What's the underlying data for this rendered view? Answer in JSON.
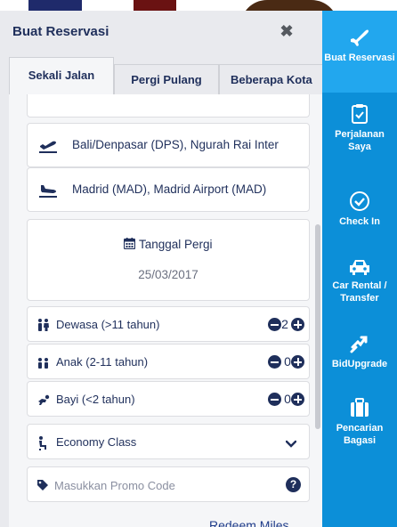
{
  "panel": {
    "title": "Buat Reservasi",
    "close_icon": "close-icon"
  },
  "tabs": [
    {
      "label": "Sekali Jalan",
      "active": true
    },
    {
      "label": "Pergi Pulang",
      "active": false
    },
    {
      "label": "Beberapa Kota",
      "active": false
    }
  ],
  "route": {
    "from": "Bali/Denpasar (DPS), Ngurah Rai Inter",
    "to": "Madrid (MAD), Madrid Airport (MAD)",
    "from_icon": "plane-departure-icon",
    "to_icon": "plane-arrival-icon"
  },
  "date": {
    "label": "Tanggal Pergi",
    "value": "25/03/2017",
    "icon": "calendar-icon"
  },
  "passengers": [
    {
      "label": "Dewasa (>11 tahun)",
      "count": "2",
      "icon": "adult-icon"
    },
    {
      "label": "Anak (2-11 tahun)",
      "count": "0",
      "icon": "child-icon"
    },
    {
      "label": "Bayi (<2 tahun)",
      "count": "0",
      "icon": "infant-icon"
    }
  ],
  "cabin_class": {
    "value": "Economy Class",
    "icon": "seat-icon"
  },
  "promo": {
    "placeholder": "Masukkan Promo Code",
    "icon": "tag-icon"
  },
  "redeem": {
    "label": "Redeem Miles"
  },
  "rail": [
    {
      "label": "Buat Reservasi",
      "icon": "plane-icon",
      "active": true
    },
    {
      "label": "Perjalanan Saya",
      "icon": "clipboard-check-icon",
      "active": false
    },
    {
      "label": "Check In",
      "icon": "check-circle-icon",
      "active": false
    },
    {
      "label": "Car Rental / Transfer",
      "icon": "car-icon",
      "active": false
    },
    {
      "label": "BidUpgrade",
      "icon": "upgrade-icon",
      "active": false
    },
    {
      "label": "Pencarian Bagasi",
      "icon": "luggage-icon",
      "active": false
    }
  ],
  "colors": {
    "navy": "#1f2f5b",
    "rail_blue": "#0c8fd8",
    "rail_active": "#22a7ee",
    "panel_bg": "#e9eaee"
  }
}
